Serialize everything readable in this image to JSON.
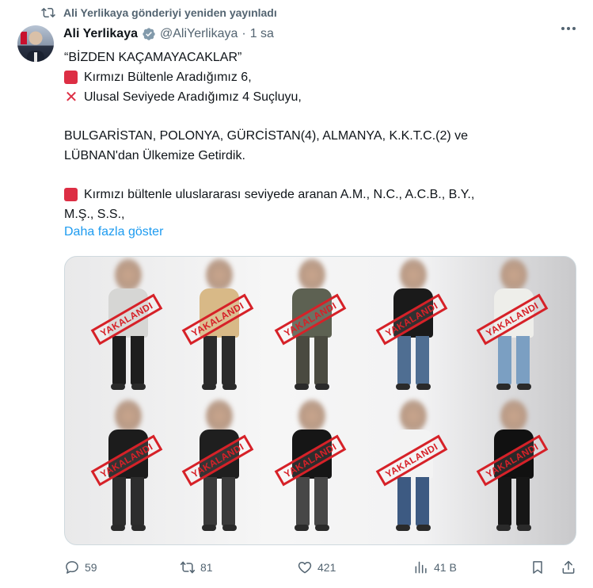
{
  "repost": {
    "text": "Ali Yerlikaya gönderiyi yeniden yayınladı",
    "icon": "repost-icon"
  },
  "author": {
    "name": "Ali Yerlikaya",
    "handle": "@AliYerlikaya",
    "separator": "·",
    "time": "1 sa",
    "verified_color": "#829aab"
  },
  "tweet": {
    "lines": [
      {
        "icon": "",
        "text": "“BİZDEN KAÇAMAYACAKLAR”"
      },
      {
        "icon": "red-square",
        "text": "Kırmızı Bültenle Aradığımız 6,"
      },
      {
        "icon": "cross-mark",
        "text": "Ulusal Seviyede Aradığımız 4 Suçluyu,"
      },
      {
        "icon": "",
        "text": ""
      },
      {
        "icon": "",
        "text": "BULGARİSTAN, POLONYA, GÜRCİSTAN(4), ALMANYA, K.K.T.C.(2) ve"
      },
      {
        "icon": "",
        "text": "LÜBNAN'dan Ülkemize Getirdik."
      },
      {
        "icon": "",
        "text": ""
      },
      {
        "icon": "red-square",
        "text": "Kırmızı bültenle uluslararası seviyede aranan A.M., N.C., A.C.B., B.Y.,"
      },
      {
        "icon": "",
        "text": "M.Ş., S.S.,"
      }
    ],
    "show_more": "Daha fazla göster",
    "cross_glyph": "✕"
  },
  "media": {
    "stamp_text": "YAKALANDI",
    "people": [
      {
        "shirt": "#d6d6d4",
        "pants": "#1e1e1e"
      },
      {
        "shirt": "#d8b987",
        "pants": "#2b2b2b"
      },
      {
        "shirt": "#5d6152",
        "pants": "#4a4a40"
      },
      {
        "shirt": "#1a1a1a",
        "pants": "#4f6e92"
      },
      {
        "shirt": "#eeeeea",
        "pants": "#7b9fc2"
      },
      {
        "shirt": "#1c1c1c",
        "pants": "#2d2d2d"
      },
      {
        "shirt": "#1f1f1f",
        "pants": "#3a3a3a"
      },
      {
        "shirt": "#161616",
        "pants": "#474747"
      },
      {
        "shirt": "#f3f3f3",
        "pants": "#3d5a82"
      },
      {
        "shirt": "#111111",
        "pants": "#161616"
      }
    ]
  },
  "actions": {
    "reply_count": "59",
    "repost_count": "81",
    "like_count": "421",
    "views_count": "41 B"
  }
}
